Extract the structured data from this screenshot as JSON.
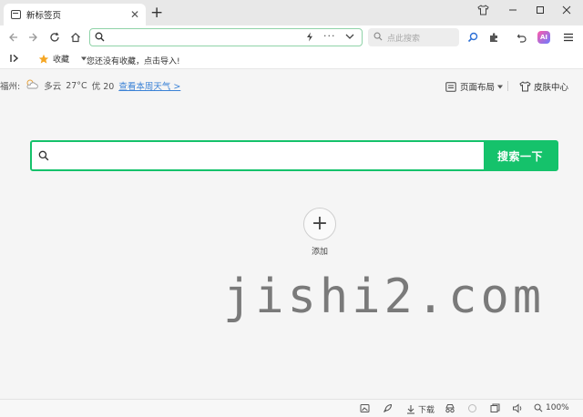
{
  "tab": {
    "title": "新标签页"
  },
  "toolbar": {
    "address_value": "",
    "search_placeholder": "点此搜索",
    "ai_label": "AI"
  },
  "bookmarks": {
    "favorites_label": "收藏",
    "empty_hint": "您还没有收藏，点击导入!"
  },
  "weather": {
    "city": "福州:",
    "condition": "多云",
    "temperature": "27°C",
    "aqi": "优 20",
    "forecast_link": "查看本周天气 >"
  },
  "topright": {
    "layout_label": "页面布局",
    "skin_label": "皮肤中心"
  },
  "search": {
    "placeholder": "",
    "button_label": "搜索一下"
  },
  "quick_add": {
    "label": "添加"
  },
  "watermark": "jishi2.com",
  "statusbar": {
    "download_label": "下载",
    "zoom": "100%"
  },
  "colors": {
    "accent": "#15c26b",
    "link": "#3b82d6"
  }
}
